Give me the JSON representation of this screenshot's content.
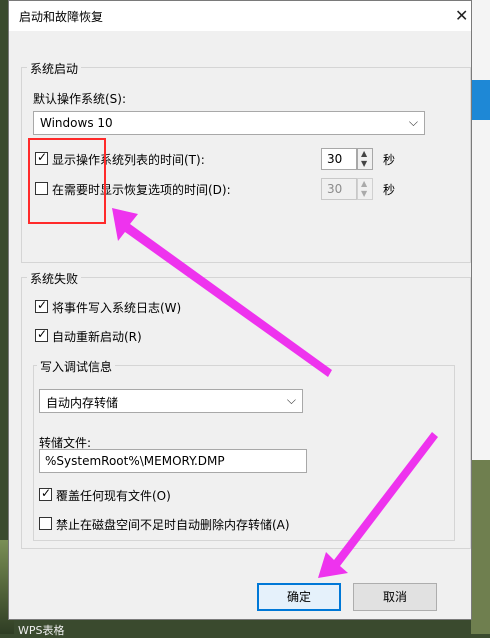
{
  "window": {
    "title": "启动和故障恢复"
  },
  "system_startup": {
    "group_label": "系统启动",
    "default_os_label": "默认操作系统(S):",
    "default_os_value": "Windows 10",
    "show_os_list": {
      "label": "显示操作系统列表的时间(T):",
      "checked": true,
      "value": "30",
      "unit": "秒"
    },
    "show_recovery": {
      "label": "在需要时显示恢复选项的时间(D):",
      "checked": false,
      "value": "30",
      "unit": "秒"
    }
  },
  "system_failure": {
    "group_label": "系统失败",
    "write_event_log": {
      "label": "将事件写入系统日志(W)",
      "checked": true
    },
    "auto_restart": {
      "label": "自动重新启动(R)",
      "checked": true
    },
    "debug_info": {
      "group_label": "写入调试信息",
      "type_value": "自动内存转储",
      "dump_file_label": "转储文件:",
      "dump_file_value": "%SystemRoot%\\MEMORY.DMP",
      "overwrite": {
        "label": "覆盖任何现有文件(O)",
        "checked": true
      },
      "disable_low_disk": {
        "label": "禁止在磁盘空间不足时自动删除内存转储(A)",
        "checked": false
      }
    }
  },
  "buttons": {
    "ok": "确定",
    "cancel": "取消"
  },
  "taskbar_text": "WPS表格",
  "colors": {
    "highlight_box": "#ff2a2a",
    "arrow": "#ee33ee",
    "primary_border": "#0078d7"
  }
}
